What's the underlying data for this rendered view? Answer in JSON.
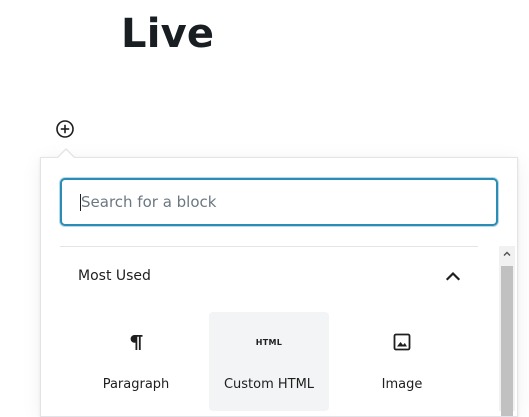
{
  "page": {
    "title": "Live"
  },
  "inserter": {
    "toggle_icon": "plus-circle-icon",
    "search": {
      "placeholder": "Search for a block",
      "value": ""
    },
    "panel": {
      "title": "Most Used",
      "toggle_icon": "chevron-up-icon",
      "expanded": true
    },
    "blocks": [
      {
        "label": "Paragraph",
        "icon": "paragraph-icon",
        "icon_text": ""
      },
      {
        "label": "Custom HTML",
        "icon": "html-icon",
        "icon_text": "HTML",
        "hovered": true
      },
      {
        "label": "Image",
        "icon": "image-icon",
        "icon_text": ""
      }
    ]
  },
  "colors": {
    "focus_border": "#2d8cb4",
    "hover_bg": "#f3f4f5",
    "divider": "#e2e4e7"
  }
}
